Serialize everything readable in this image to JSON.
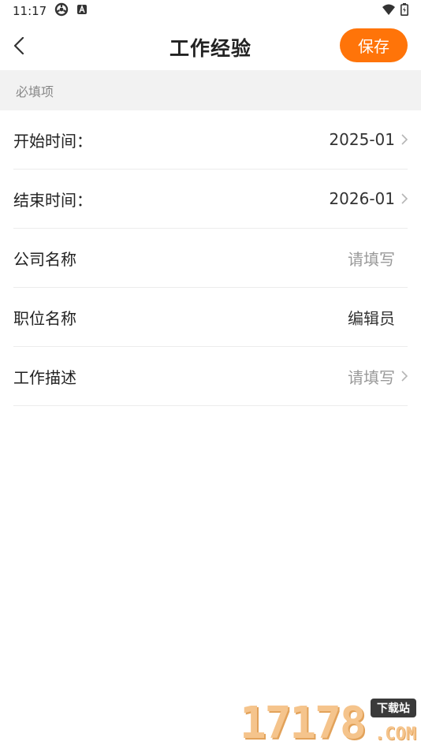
{
  "status_bar": {
    "time": "11:17"
  },
  "nav": {
    "title": "工作经验",
    "save_label": "保存"
  },
  "section": {
    "title": "必填项"
  },
  "rows": [
    {
      "label": "开始时间：",
      "value": "2025-01",
      "placeholder": false,
      "chevron": true
    },
    {
      "label": "结束时间：",
      "value": "2026-01",
      "placeholder": false,
      "chevron": true
    },
    {
      "label": "公司名称",
      "value": "请填写",
      "placeholder": true,
      "chevron": false
    },
    {
      "label": "职位名称",
      "value": "编辑员",
      "placeholder": false,
      "chevron": false
    },
    {
      "label": "工作描述",
      "value": "请填写",
      "placeholder": true,
      "chevron": true
    }
  ],
  "watermark": {
    "numbers": "17178",
    "badge": "下载站",
    "domain": ".COM"
  },
  "colors": {
    "accent": "#ff7409",
    "section_bg": "#f2f2f2",
    "placeholder": "#999999"
  }
}
